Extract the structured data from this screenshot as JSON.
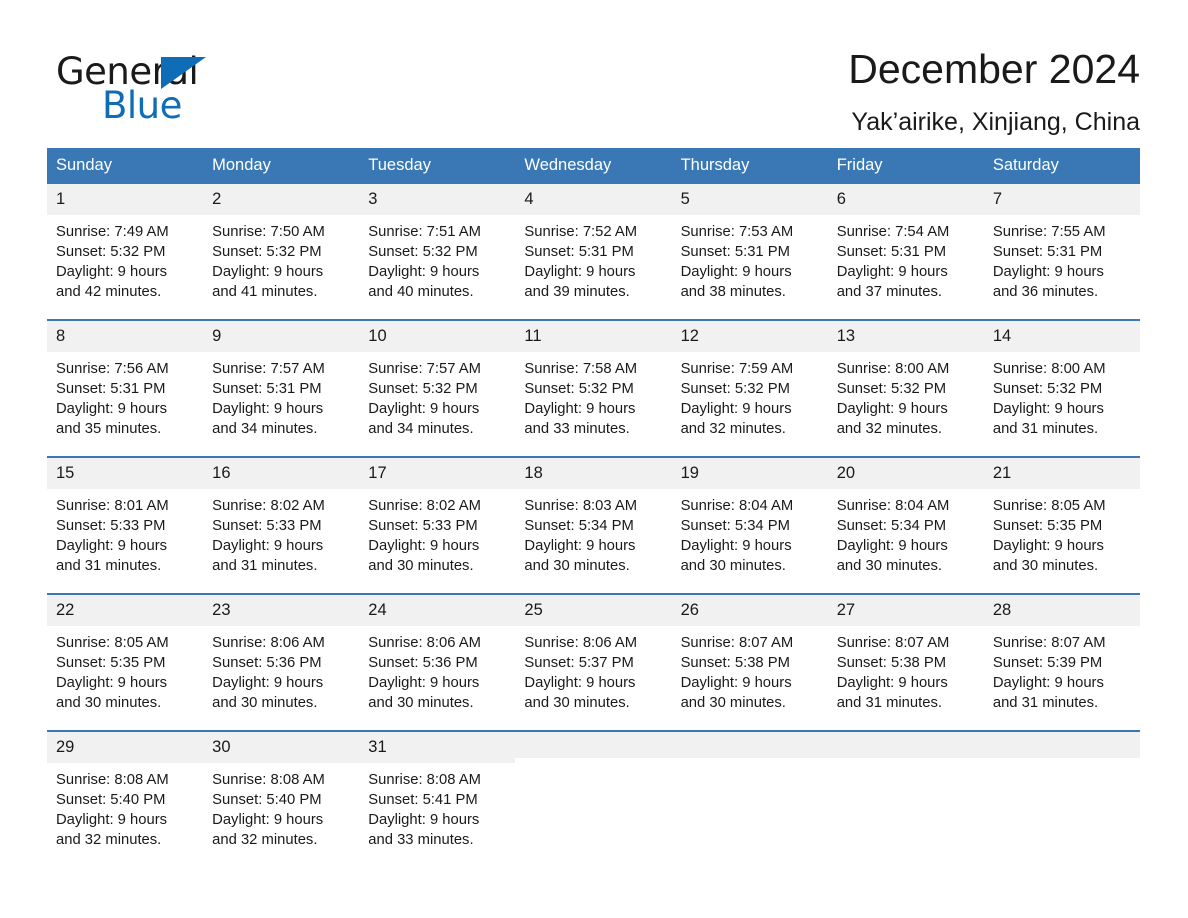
{
  "brand": {
    "name_part1": "General",
    "name_part2": "Blue",
    "triangle_color": "#0f6cb6",
    "text_color": "#1a1a1a"
  },
  "header": {
    "month_title": "December 2024",
    "location": "Yak’airike, Xinjiang, China"
  },
  "theme": {
    "header_blue": "#3a78b5",
    "daynum_bg": "#f1f1f1",
    "page_bg": "#ffffff",
    "text": "#1a1a1a"
  },
  "weekdays": [
    "Sunday",
    "Monday",
    "Tuesday",
    "Wednesday",
    "Thursday",
    "Friday",
    "Saturday"
  ],
  "labels": {
    "sunrise_prefix": "Sunrise:",
    "sunset_prefix": "Sunset:",
    "daylight_prefix": "Daylight:"
  },
  "weeks": [
    [
      {
        "day": "1",
        "sunrise": "Sunrise: 7:49 AM",
        "sunset": "Sunset: 5:32 PM",
        "daylight_line1": "Daylight: 9 hours",
        "daylight_line2": "and 42 minutes."
      },
      {
        "day": "2",
        "sunrise": "Sunrise: 7:50 AM",
        "sunset": "Sunset: 5:32 PM",
        "daylight_line1": "Daylight: 9 hours",
        "daylight_line2": "and 41 minutes."
      },
      {
        "day": "3",
        "sunrise": "Sunrise: 7:51 AM",
        "sunset": "Sunset: 5:32 PM",
        "daylight_line1": "Daylight: 9 hours",
        "daylight_line2": "and 40 minutes."
      },
      {
        "day": "4",
        "sunrise": "Sunrise: 7:52 AM",
        "sunset": "Sunset: 5:31 PM",
        "daylight_line1": "Daylight: 9 hours",
        "daylight_line2": "and 39 minutes."
      },
      {
        "day": "5",
        "sunrise": "Sunrise: 7:53 AM",
        "sunset": "Sunset: 5:31 PM",
        "daylight_line1": "Daylight: 9 hours",
        "daylight_line2": "and 38 minutes."
      },
      {
        "day": "6",
        "sunrise": "Sunrise: 7:54 AM",
        "sunset": "Sunset: 5:31 PM",
        "daylight_line1": "Daylight: 9 hours",
        "daylight_line2": "and 37 minutes."
      },
      {
        "day": "7",
        "sunrise": "Sunrise: 7:55 AM",
        "sunset": "Sunset: 5:31 PM",
        "daylight_line1": "Daylight: 9 hours",
        "daylight_line2": "and 36 minutes."
      }
    ],
    [
      {
        "day": "8",
        "sunrise": "Sunrise: 7:56 AM",
        "sunset": "Sunset: 5:31 PM",
        "daylight_line1": "Daylight: 9 hours",
        "daylight_line2": "and 35 minutes."
      },
      {
        "day": "9",
        "sunrise": "Sunrise: 7:57 AM",
        "sunset": "Sunset: 5:31 PM",
        "daylight_line1": "Daylight: 9 hours",
        "daylight_line2": "and 34 minutes."
      },
      {
        "day": "10",
        "sunrise": "Sunrise: 7:57 AM",
        "sunset": "Sunset: 5:32 PM",
        "daylight_line1": "Daylight: 9 hours",
        "daylight_line2": "and 34 minutes."
      },
      {
        "day": "11",
        "sunrise": "Sunrise: 7:58 AM",
        "sunset": "Sunset: 5:32 PM",
        "daylight_line1": "Daylight: 9 hours",
        "daylight_line2": "and 33 minutes."
      },
      {
        "day": "12",
        "sunrise": "Sunrise: 7:59 AM",
        "sunset": "Sunset: 5:32 PM",
        "daylight_line1": "Daylight: 9 hours",
        "daylight_line2": "and 32 minutes."
      },
      {
        "day": "13",
        "sunrise": "Sunrise: 8:00 AM",
        "sunset": "Sunset: 5:32 PM",
        "daylight_line1": "Daylight: 9 hours",
        "daylight_line2": "and 32 minutes."
      },
      {
        "day": "14",
        "sunrise": "Sunrise: 8:00 AM",
        "sunset": "Sunset: 5:32 PM",
        "daylight_line1": "Daylight: 9 hours",
        "daylight_line2": "and 31 minutes."
      }
    ],
    [
      {
        "day": "15",
        "sunrise": "Sunrise: 8:01 AM",
        "sunset": "Sunset: 5:33 PM",
        "daylight_line1": "Daylight: 9 hours",
        "daylight_line2": "and 31 minutes."
      },
      {
        "day": "16",
        "sunrise": "Sunrise: 8:02 AM",
        "sunset": "Sunset: 5:33 PM",
        "daylight_line1": "Daylight: 9 hours",
        "daylight_line2": "and 31 minutes."
      },
      {
        "day": "17",
        "sunrise": "Sunrise: 8:02 AM",
        "sunset": "Sunset: 5:33 PM",
        "daylight_line1": "Daylight: 9 hours",
        "daylight_line2": "and 30 minutes."
      },
      {
        "day": "18",
        "sunrise": "Sunrise: 8:03 AM",
        "sunset": "Sunset: 5:34 PM",
        "daylight_line1": "Daylight: 9 hours",
        "daylight_line2": "and 30 minutes."
      },
      {
        "day": "19",
        "sunrise": "Sunrise: 8:04 AM",
        "sunset": "Sunset: 5:34 PM",
        "daylight_line1": "Daylight: 9 hours",
        "daylight_line2": "and 30 minutes."
      },
      {
        "day": "20",
        "sunrise": "Sunrise: 8:04 AM",
        "sunset": "Sunset: 5:34 PM",
        "daylight_line1": "Daylight: 9 hours",
        "daylight_line2": "and 30 minutes."
      },
      {
        "day": "21",
        "sunrise": "Sunrise: 8:05 AM",
        "sunset": "Sunset: 5:35 PM",
        "daylight_line1": "Daylight: 9 hours",
        "daylight_line2": "and 30 minutes."
      }
    ],
    [
      {
        "day": "22",
        "sunrise": "Sunrise: 8:05 AM",
        "sunset": "Sunset: 5:35 PM",
        "daylight_line1": "Daylight: 9 hours",
        "daylight_line2": "and 30 minutes."
      },
      {
        "day": "23",
        "sunrise": "Sunrise: 8:06 AM",
        "sunset": "Sunset: 5:36 PM",
        "daylight_line1": "Daylight: 9 hours",
        "daylight_line2": "and 30 minutes."
      },
      {
        "day": "24",
        "sunrise": "Sunrise: 8:06 AM",
        "sunset": "Sunset: 5:36 PM",
        "daylight_line1": "Daylight: 9 hours",
        "daylight_line2": "and 30 minutes."
      },
      {
        "day": "25",
        "sunrise": "Sunrise: 8:06 AM",
        "sunset": "Sunset: 5:37 PM",
        "daylight_line1": "Daylight: 9 hours",
        "daylight_line2": "and 30 minutes."
      },
      {
        "day": "26",
        "sunrise": "Sunrise: 8:07 AM",
        "sunset": "Sunset: 5:38 PM",
        "daylight_line1": "Daylight: 9 hours",
        "daylight_line2": "and 30 minutes."
      },
      {
        "day": "27",
        "sunrise": "Sunrise: 8:07 AM",
        "sunset": "Sunset: 5:38 PM",
        "daylight_line1": "Daylight: 9 hours",
        "daylight_line2": "and 31 minutes."
      },
      {
        "day": "28",
        "sunrise": "Sunrise: 8:07 AM",
        "sunset": "Sunset: 5:39 PM",
        "daylight_line1": "Daylight: 9 hours",
        "daylight_line2": "and 31 minutes."
      }
    ],
    [
      {
        "day": "29",
        "sunrise": "Sunrise: 8:08 AM",
        "sunset": "Sunset: 5:40 PM",
        "daylight_line1": "Daylight: 9 hours",
        "daylight_line2": "and 32 minutes."
      },
      {
        "day": "30",
        "sunrise": "Sunrise: 8:08 AM",
        "sunset": "Sunset: 5:40 PM",
        "daylight_line1": "Daylight: 9 hours",
        "daylight_line2": "and 32 minutes."
      },
      {
        "day": "31",
        "sunrise": "Sunrise: 8:08 AM",
        "sunset": "Sunset: 5:41 PM",
        "daylight_line1": "Daylight: 9 hours",
        "daylight_line2": "and 33 minutes."
      },
      {
        "day": "",
        "sunrise": "",
        "sunset": "",
        "daylight_line1": "",
        "daylight_line2": ""
      },
      {
        "day": "",
        "sunrise": "",
        "sunset": "",
        "daylight_line1": "",
        "daylight_line2": ""
      },
      {
        "day": "",
        "sunrise": "",
        "sunset": "",
        "daylight_line1": "",
        "daylight_line2": ""
      },
      {
        "day": "",
        "sunrise": "",
        "sunset": "",
        "daylight_line1": "",
        "daylight_line2": ""
      }
    ]
  ]
}
